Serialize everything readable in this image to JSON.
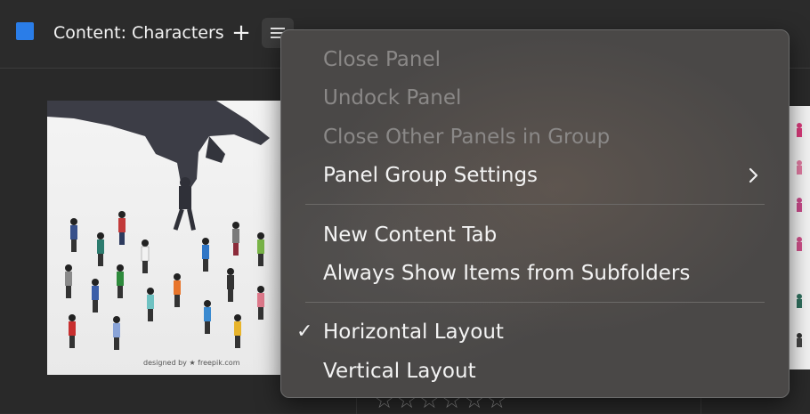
{
  "panel": {
    "title": "Content: Characters",
    "add_tab_glyph": "+",
    "swatch_color": "#2a7de8",
    "menu_icon": "hamburger-menu-icon"
  },
  "thumbnail": {
    "credit": "designed by ★ freepik.com"
  },
  "rating": {
    "stars": "☆☆☆☆☆☆"
  },
  "menu": {
    "items": [
      {
        "label": "Close Panel",
        "enabled": false
      },
      {
        "label": "Undock Panel",
        "enabled": false
      },
      {
        "label": "Close Other Panels in Group",
        "enabled": false
      },
      {
        "label": "Panel Group Settings",
        "enabled": true,
        "submenu": true
      },
      {
        "label": "New Content Tab",
        "enabled": true
      },
      {
        "label": "Always Show Items from Subfolders",
        "enabled": true
      },
      {
        "label": "Horizontal Layout",
        "enabled": true,
        "checked": true,
        "check_glyph": "✓"
      },
      {
        "label": "Vertical Layout",
        "enabled": true,
        "checked": false
      }
    ]
  }
}
